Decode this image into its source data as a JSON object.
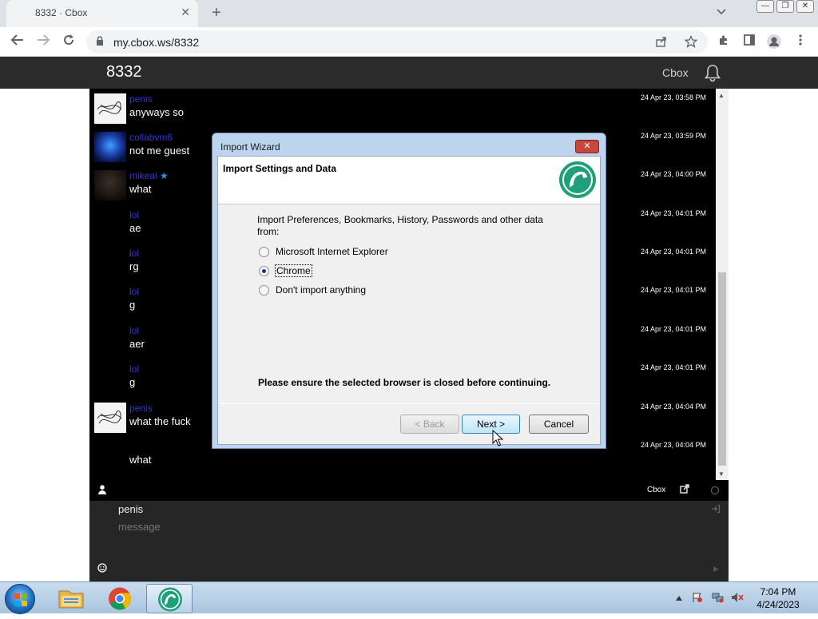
{
  "browser": {
    "tab_title": "8332 · Cbox",
    "tab_close": "✕",
    "new_tab": "+",
    "url": "my.cbox.ws/8332",
    "window_buttons": [
      "—",
      "❐",
      "✕"
    ]
  },
  "header": {
    "title": "8332",
    "cbox_link": "Cbox"
  },
  "messages": [
    {
      "user": "penis",
      "text": "anyways so",
      "time": "24 Apr 23, 03:58 PM",
      "avatar": "scribble"
    },
    {
      "user": "collabvm6",
      "text": "not me guest",
      "time": "24 Apr 23, 03:59 PM",
      "avatar": "blue"
    },
    {
      "user": "mikeal",
      "text": "what",
      "time": "24 Apr 23, 04:00 PM",
      "avatar": "dark",
      "star": "★"
    },
    {
      "user": "lol",
      "text": "ae",
      "time": "24 Apr 23, 04:01 PM",
      "avatar": "none"
    },
    {
      "user": "lol",
      "text": "rg",
      "time": "24 Apr 23, 04:01 PM",
      "avatar": "none"
    },
    {
      "user": "lol",
      "text": "g",
      "time": "24 Apr 23, 04:01 PM",
      "avatar": "none"
    },
    {
      "user": "lol",
      "text": "aer",
      "time": "24 Apr 23, 04:01 PM",
      "avatar": "none"
    },
    {
      "user": "lol",
      "text": "g",
      "time": "24 Apr 23, 04:01 PM",
      "avatar": "none"
    },
    {
      "user": "penis",
      "text": "what the fuck",
      "time": "24 Apr 23, 04:04 PM",
      "avatar": "scribble"
    },
    {
      "user": "",
      "text": "what",
      "time": "24 Apr 23, 04:04 PM",
      "avatar": "none"
    }
  ],
  "chat_bar": {
    "cbox_label": "Cbox"
  },
  "input": {
    "name_value": "penis",
    "message_placeholder": "message"
  },
  "dialog": {
    "title": "Import Wizard",
    "close_label": "✕",
    "heading": "Import Settings and Data",
    "prompt": "Import Preferences, Bookmarks, History, Passwords and other data from:",
    "options": [
      {
        "label": "Microsoft Internet Explorer",
        "checked": false
      },
      {
        "label": "Chrome",
        "checked": true
      },
      {
        "label": "Don't import anything",
        "checked": false
      }
    ],
    "note": "Please ensure the selected browser is closed before continuing.",
    "back_label": "< Back",
    "next_label": "Next >",
    "cancel_label": "Cancel"
  },
  "taskbar": {
    "time": "7:04 PM",
    "date": "4/24/2023"
  },
  "colors": {
    "username": "#2f35d6",
    "dialog_frame": "#bcd4ee",
    "brand_teal": "#1f9f7a"
  }
}
